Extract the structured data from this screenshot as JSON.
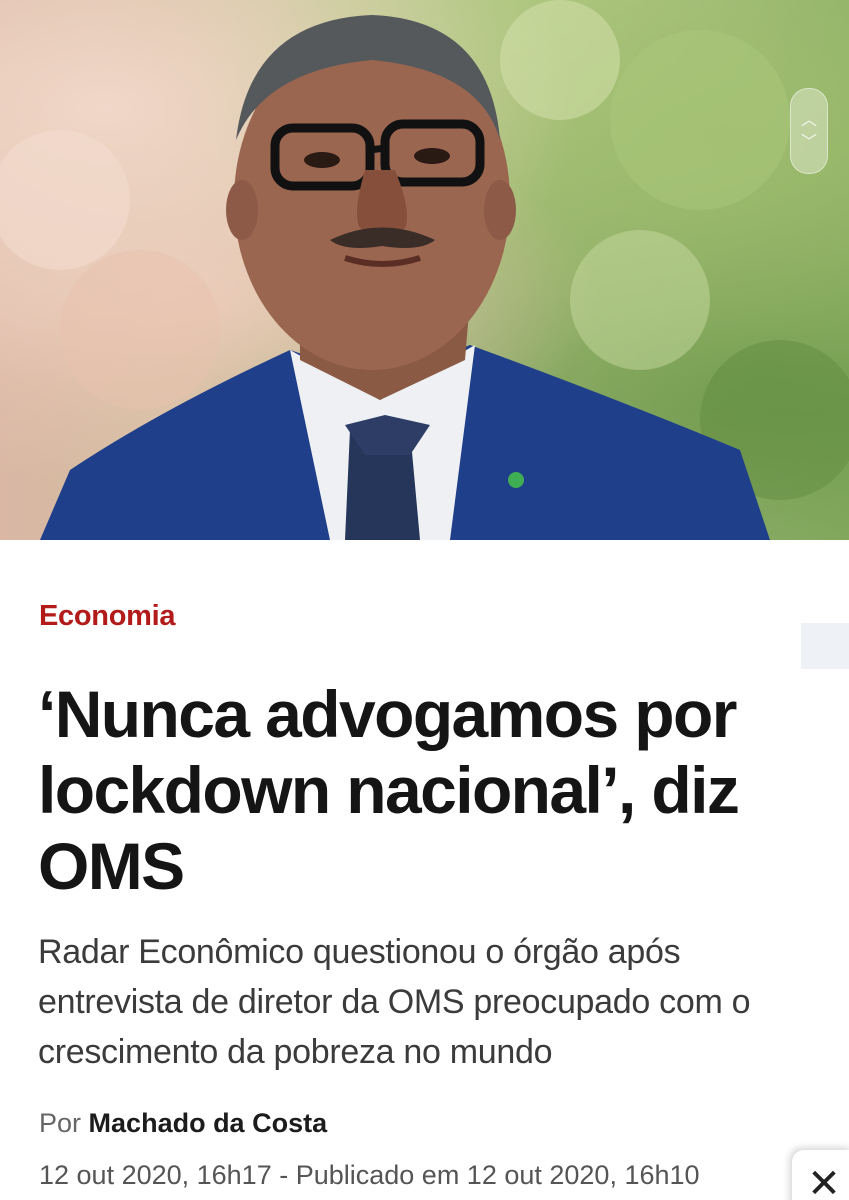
{
  "hero": {
    "image_icon": "portrait-photo"
  },
  "scroll_widget": {
    "up_icon": "chevron-up-icon",
    "down_icon": "chevron-down-icon",
    "up_glyph": "︿",
    "down_glyph": "﹀"
  },
  "article": {
    "category": "Economia",
    "headline": "‘Nunca advogamos por lockdown nacional’, diz OMS",
    "dek": "Radar Econômico questionou o órgão após entrevista de diretor da OMS preocupado com o crescimento da pobreza no mundo",
    "byline_prefix": "Por",
    "author": "Machado da Costa",
    "dates": "12 out 2020, 16h17 - Publicado em 12 out 2020, 16h10"
  },
  "close_button": {
    "glyph": "✕",
    "icon": "close-icon"
  },
  "colors": {
    "category": "#b31b1b",
    "headline": "#151515",
    "dek": "#3b3b3b"
  }
}
